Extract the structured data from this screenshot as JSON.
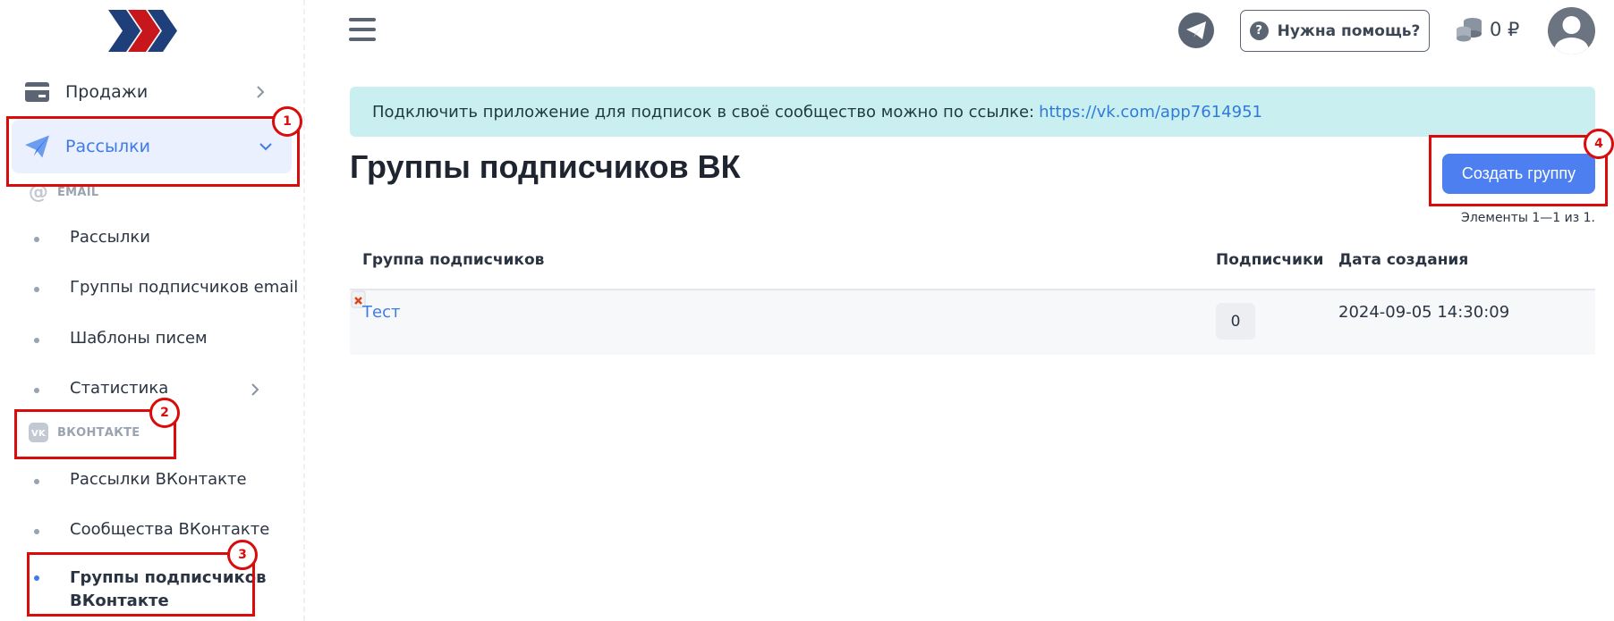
{
  "sidebar": {
    "logo_icon": "chevrons-logo",
    "top_items": [
      {
        "label": "Продажи",
        "icon": "card-icon"
      },
      {
        "label": "Рассылки",
        "icon": "paper-plane-icon"
      }
    ],
    "email_section": {
      "label": "EMAIL",
      "items": [
        {
          "label": "Рассылки"
        },
        {
          "label": "Группы подписчиков email"
        },
        {
          "label": "Шаблоны писем"
        },
        {
          "label": "Статистика"
        }
      ]
    },
    "vk_section": {
      "label": "ВКОНТАКТЕ",
      "items": [
        {
          "label": "Рассылки ВКонтакте"
        },
        {
          "label": "Сообщества ВКонтакте"
        },
        {
          "label": "Группы подписчиков ВКонтакте"
        }
      ]
    }
  },
  "header": {
    "help_label": "Нужна помощь?",
    "help_icon_glyph": "?",
    "balance": "0 ₽"
  },
  "alert": {
    "text": "Подключить приложение для подписок в своё сообщество можно по ссылке:",
    "link": "https://vk.com/app7614951"
  },
  "page": {
    "title": "Группы подписчиков ВК",
    "create_button": "Создать группу",
    "summary": "Элементы 1—1 из 1."
  },
  "table": {
    "headers": [
      "Группа подписчиков",
      "Подписчики",
      "Дата создания"
    ],
    "rows": [
      {
        "name": "Тест",
        "subscribers": "0",
        "created": "2024-09-05 14:30:09"
      }
    ]
  },
  "annotations": {
    "badges": [
      "1",
      "2",
      "3",
      "4"
    ],
    "color": "#d90b0b"
  },
  "colors": {
    "accent": "#3f7be8",
    "button": "#4d7ff0",
    "alert_bg": "#c9eff1"
  }
}
